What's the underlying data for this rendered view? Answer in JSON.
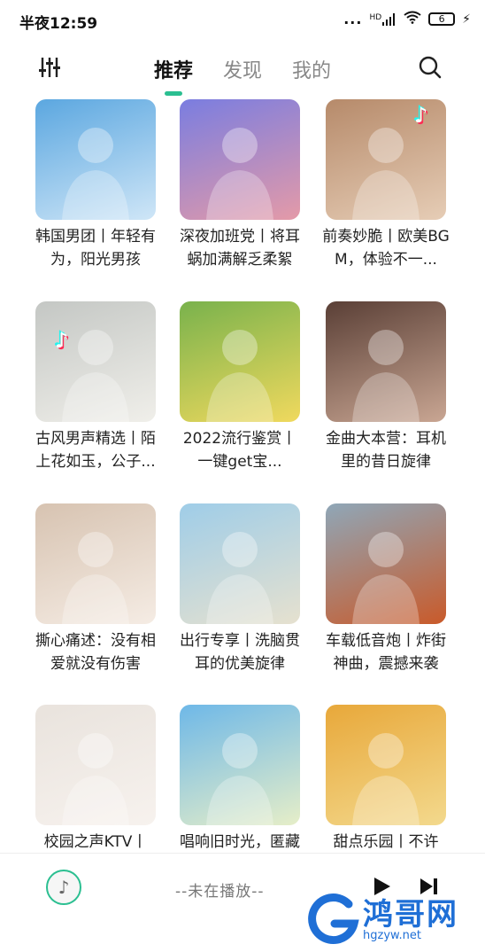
{
  "statusbar": {
    "time": "半夜12:59",
    "dots": "...",
    "network": "HD",
    "battery": "6"
  },
  "header": {
    "tabs": [
      {
        "label": "推荐",
        "active": true
      },
      {
        "label": "发现",
        "active": false
      },
      {
        "label": "我的",
        "active": false
      }
    ],
    "menu_icon": "equalizer-sliders-icon",
    "search_icon": "search-icon"
  },
  "playlists": [
    {
      "title": "韩国男团丨年轻有为，阳光男孩",
      "bg": [
        "#5ba7e0",
        "#cfe6f7"
      ]
    },
    {
      "title": "深夜加班党丨将耳蜗加满解乏柔絮",
      "bg": [
        "#7a7de0",
        "#e49aa8"
      ]
    },
    {
      "title": "前奏妙脆丨欧美BGM，体验不一...",
      "bg": [
        "#b68a6a",
        "#e6cdb6"
      ]
    },
    {
      "title": "古风男声精选丨陌上花如玉，公子...",
      "bg": [
        "#c4c7c4",
        "#f0efea"
      ]
    },
    {
      "title": "2022流行鉴赏丨一键get宝...",
      "bg": [
        "#79b24c",
        "#f0d95e"
      ]
    },
    {
      "title": "金曲大本营：耳机里的昔日旋律",
      "bg": [
        "#5a3f36",
        "#c9a693"
      ]
    },
    {
      "title": "撕心痛述：没有相爱就没有伤害",
      "bg": [
        "#d7c3b1",
        "#f5ece4"
      ]
    },
    {
      "title": "出行专享丨洗脑贯耳的优美旋律",
      "bg": [
        "#9fcde8",
        "#e6e1cf"
      ]
    },
    {
      "title": "车载低音炮丨炸街神曲，震撼来袭",
      "bg": [
        "#8fa7b8",
        "#c95a2a"
      ]
    },
    {
      "title": "校园之声KTV丨",
      "bg": [
        "#e9e3dd",
        "#f7f2ee"
      ]
    },
    {
      "title": "唱响旧时光，匿藏",
      "bg": [
        "#6eb8e8",
        "#e6eec8"
      ]
    },
    {
      "title": "甜点乐园丨不许",
      "bg": [
        "#e8a83a",
        "#f3d98d"
      ]
    }
  ],
  "player": {
    "now_playing": "--未在播放--",
    "play_icon": "play-icon",
    "next_icon": "skip-next-icon"
  },
  "watermark": {
    "name": "鸿哥网",
    "url": "hgzyw.net"
  },
  "colors": {
    "accent": "#2bbf91",
    "watermark_blue": "#1f6fd6"
  }
}
